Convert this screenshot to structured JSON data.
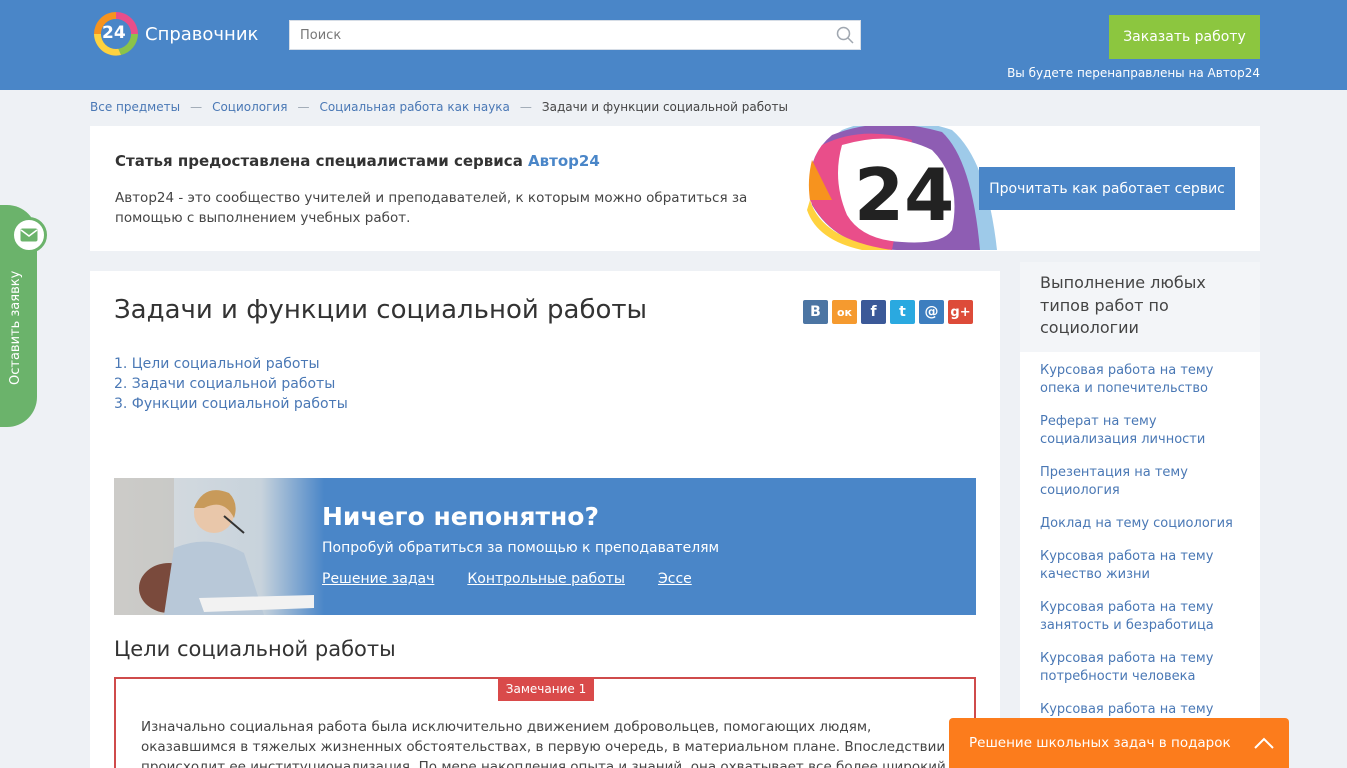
{
  "header": {
    "logo_number": "24",
    "logo_text": "Справочник",
    "search_placeholder": "Поиск",
    "order_button": "Заказать работу",
    "redirect_note": "Вы будете перенаправлены на Автор24"
  },
  "breadcrumb": {
    "items": [
      "Все предметы",
      "Социология",
      "Социальная работа как наука"
    ],
    "separator": "—",
    "current": "Задачи и функции социальной работы"
  },
  "promo": {
    "title_prefix": "Статья предоставлена специалистами сервиса ",
    "title_brand": "Автор24",
    "description": "Автор24 - это сообщество учителей и преподавателей, к которым можно обратиться за помощью с выполнением учебных работ.",
    "logo_number": "24",
    "button": "Прочитать как работает сервис"
  },
  "article": {
    "title": "Задачи и функции социальной работы",
    "share": {
      "vk": "В",
      "ok": "ок",
      "fb": "f",
      "tw": "t",
      "mail": "@",
      "gplus": "g+"
    },
    "toc": [
      "1. Цели социальной работы",
      "2. Задачи социальной работы",
      "3. Функции социальной работы"
    ],
    "banner": {
      "title": "Ничего непонятно?",
      "subtitle": "Попробуй обратиться за помощью к преподавателям",
      "links": [
        "Решение задач",
        "Контрольные работы",
        "Эссе"
      ]
    },
    "section_title": "Цели социальной работы",
    "note": {
      "badge": "Замечание 1",
      "text": "Изначально социальная работа была исключительно движением добровольцев, помогающих людям, оказавшимся в тяжелых жизненных обстоятельствах, в первую очередь, в материальном плане. Впоследствии происходит ее институционализация. По мере накопления опыта и знаний, она охватывает все более широкий спектр социальных"
    }
  },
  "sidebar": {
    "title": "Выполнение любых типов работ по социологии",
    "links": [
      "Курсовая работа на тему опека и попечительство",
      "Реферат на тему социализация личности",
      "Презентация на тему социология",
      "Доклад на тему социология",
      "Курсовая работа на тему качество жизни",
      "Курсовая работа на тему занятость и безработица",
      "Курсовая работа на тему потребности человека",
      "Курсовая работа на тему"
    ]
  },
  "side_tab": {
    "label": "Оставить заявку"
  },
  "popup": {
    "text": "Решение школьных задач в подарок"
  },
  "colors": {
    "header": "#4a86c8",
    "order_button": "#8cc63f",
    "popup": "#fc7c1c",
    "note_border": "#cf4b4b",
    "side_tab": "#6bb36b"
  }
}
